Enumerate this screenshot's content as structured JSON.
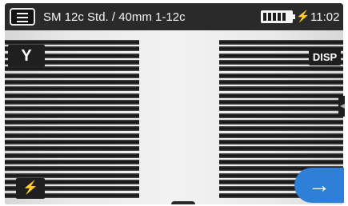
{
  "status_bar": {
    "program_title": "SM 12c Std. / 40mm 1-12c",
    "time": "11:02",
    "battery_icon": "battery-full-icon",
    "charging_icon": "charging-icon"
  },
  "buttons": {
    "y_label": "Y",
    "disp_label": "DISP",
    "arc_icon": "lightning-icon",
    "next_icon": "arrow-right-icon",
    "menu_icon": "hamburger-menu-icon"
  },
  "colors": {
    "next_button": "#2d7fd8",
    "status_bar": "#2a2a2a",
    "fiber": "#181818"
  },
  "fiber_view": {
    "left_fiber_count": 24,
    "right_fiber_count": 24
  }
}
